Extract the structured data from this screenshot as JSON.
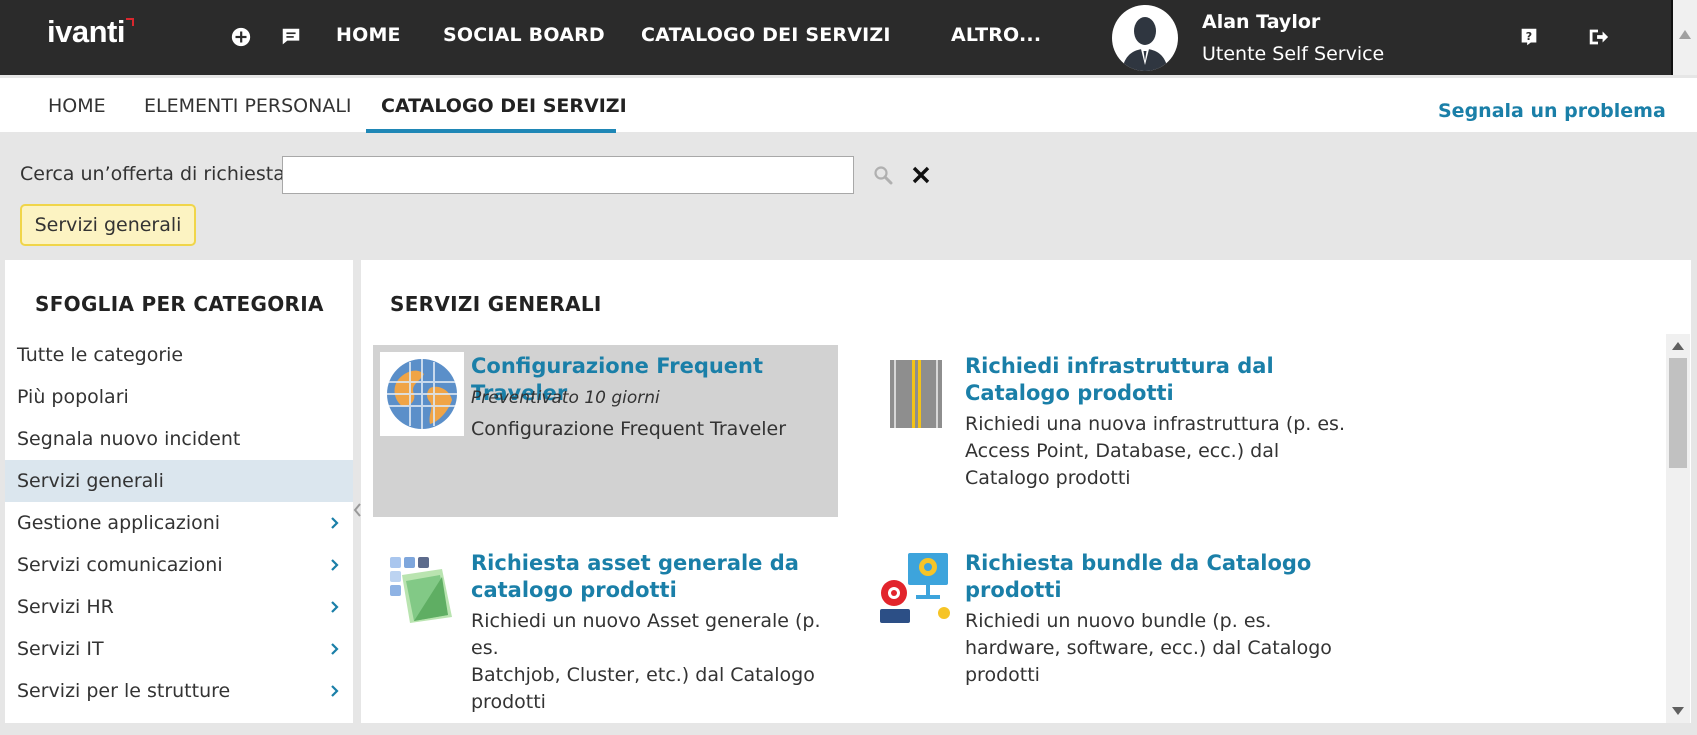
{
  "topbar": {
    "logo": "ivanti",
    "nav": [
      "HOME",
      "SOCIAL BOARD",
      "CATALOGO DEI SERVIZI",
      "ALTRO..."
    ],
    "user": {
      "name": "Alan Taylor",
      "role": "Utente Self Service"
    },
    "icons": [
      "add-icon",
      "chat-icon",
      "help-icon",
      "logout-icon"
    ]
  },
  "tabs": {
    "items": [
      "HOME",
      "ELEMENTI PERSONALI",
      "CATALOGO DEI SERVIZI"
    ],
    "active": "CATALOGO DEI SERVIZI",
    "report_link": "Segnala un problema",
    "accent": "#1f87b6"
  },
  "search": {
    "label": "Cerca un’offerta di richiesta:",
    "value": "",
    "placeholder": ""
  },
  "filter_chip": "Servizi generali",
  "categories": {
    "heading": "SFOGLIA PER CATEGORIA",
    "items": [
      {
        "label": "Tutte le categorie",
        "has_children": false
      },
      {
        "label": "Più popolari",
        "has_children": false
      },
      {
        "label": "Segnala nuovo incident",
        "has_children": false
      },
      {
        "label": "Servizi generali",
        "has_children": false,
        "selected": true
      },
      {
        "label": "Gestione applicazioni",
        "has_children": true
      },
      {
        "label": "Servizi comunicazioni",
        "has_children": true
      },
      {
        "label": "Servizi HR",
        "has_children": true
      },
      {
        "label": "Servizi IT",
        "has_children": true
      },
      {
        "label": "Servizi per le strutture",
        "has_children": true
      }
    ]
  },
  "main": {
    "heading": "SERVIZI GENERALI",
    "offers": [
      {
        "title": "Configurazione Frequent Traveler",
        "meta": "Preventivato 10 giorni",
        "description": "Configurazione Frequent Traveler",
        "icon": "globe-icon",
        "highlighted": true
      },
      {
        "title_lines": [
          "Richiedi infrastruttura dal",
          "Catalogo prodotti"
        ],
        "description_lines": [
          "Richiedi una nuova infrastruttura (p. es.",
          "Access Point, Database, ecc.) dal",
          "Catalogo prodotti"
        ],
        "icon": "road-icon"
      },
      {
        "title_lines": [
          "Richiesta asset generale da",
          "catalogo prodotti"
        ],
        "description_lines": [
          "Richiedi un nuovo Asset generale (p. es.",
          "Batchjob, Cluster, etc.) dal Catalogo",
          "prodotti"
        ],
        "icon": "asset-icon"
      },
      {
        "title_lines": [
          "Richiesta bundle da Catalogo",
          "prodotti"
        ],
        "description_lines": [
          "Richiedi un nuovo bundle (p. es.",
          "hardware, software, ecc.) dal Catalogo",
          "prodotti"
        ],
        "icon": "bundle-icon"
      }
    ]
  },
  "colors": {
    "topbar": "#2b2b2b",
    "link": "#1a7fa8",
    "chip_bg": "#fcf3c2",
    "chip_border": "#f0d54a",
    "selected_row": "#dbe6ee",
    "highlight_card": "#d2d2d2"
  }
}
